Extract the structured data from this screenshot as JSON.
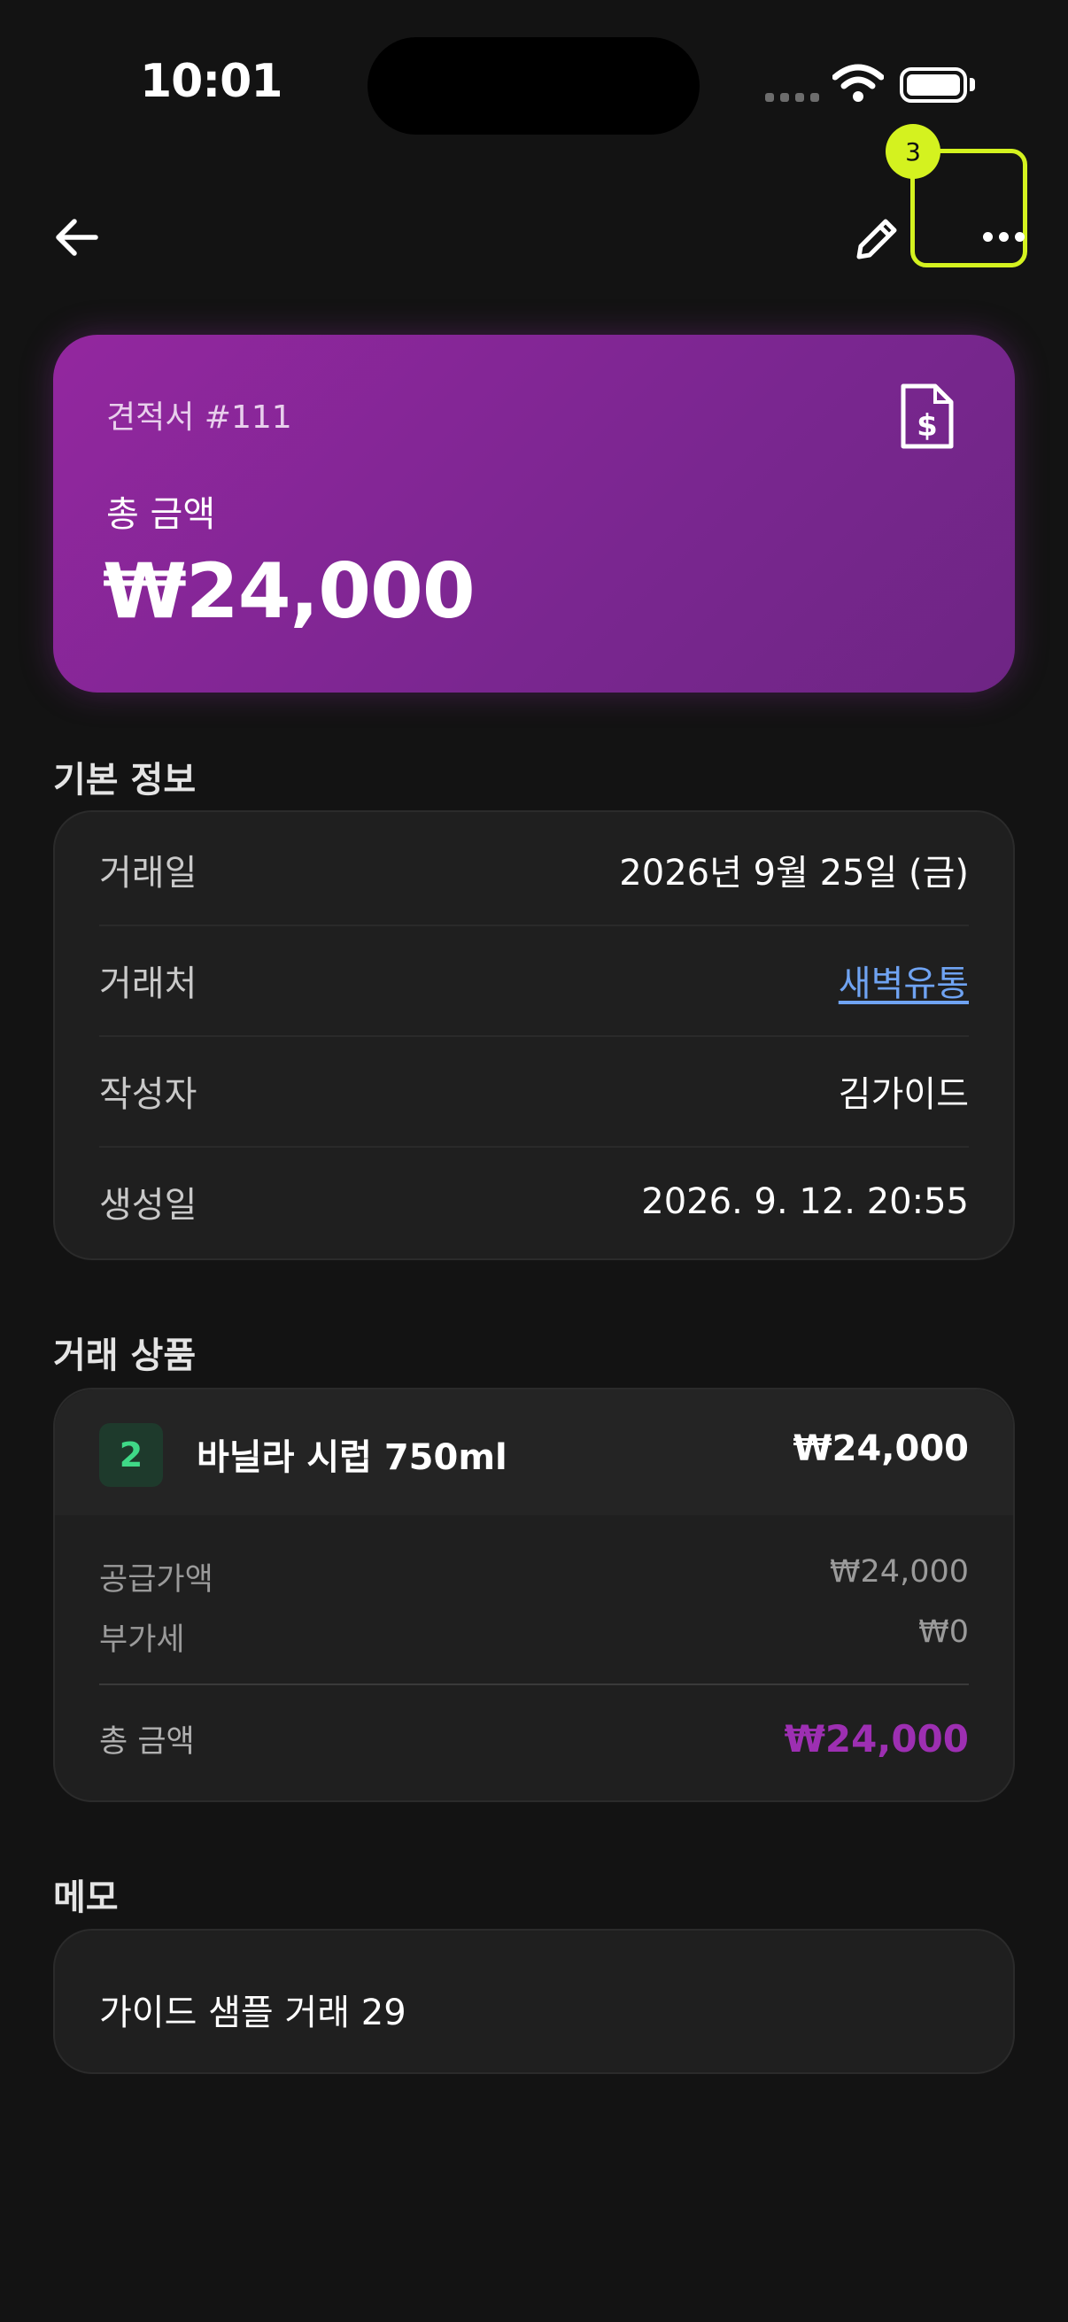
{
  "status_bar": {
    "time": "10:01"
  },
  "nav": {
    "badge": "3"
  },
  "hero": {
    "title": "견적서 #111",
    "total_label": "총 금액",
    "total_amount": "₩24,000",
    "accent": "#8e279c"
  },
  "basic_info": {
    "title": "기본 정보",
    "rows": [
      {
        "label": "거래일",
        "value": "2026년 9월 25일 (금)"
      },
      {
        "label": "거래처",
        "value": "새벽유통"
      },
      {
        "label": "작성자",
        "value": "김가이드"
      },
      {
        "label": "생성일",
        "value": "2026. 9. 12. 20:55"
      }
    ]
  },
  "items": {
    "title": "거래 상품",
    "list": [
      {
        "qty": "2",
        "name": "바닐라 시럽 750ml",
        "price": "₩24,000"
      }
    ],
    "supply_label": "공급가액",
    "supply_value": "₩24,000",
    "vat_label": "부가세",
    "vat_value": "₩0",
    "total_label": "총 금액",
    "total_value": "₩24,000"
  },
  "memo": {
    "title": "메모",
    "text": "가이드 샘플 거래 29"
  }
}
